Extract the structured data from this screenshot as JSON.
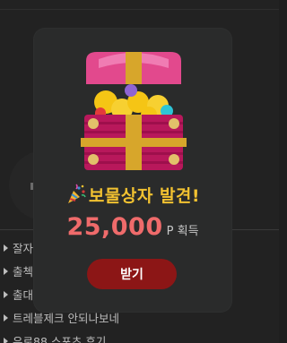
{
  "background": {
    "list_items": [
      {
        "label": "잘자"
      },
      {
        "label": "출첵"
      },
      {
        "label": "출대"
      },
      {
        "label": "트레블제크 안되나보네"
      },
      {
        "label": "유로88 스포츠 후기"
      }
    ]
  },
  "modal": {
    "title": "보물상자 발견!",
    "title_icon": "party-popper-icon",
    "reward_amount": "25,000",
    "reward_unit": "P 획득",
    "receive_button_label": "받기",
    "colors": {
      "title": "#f2c231",
      "amount": "#ef6b6b",
      "button": "#8c1616",
      "panel": "#2a2b2b"
    }
  }
}
